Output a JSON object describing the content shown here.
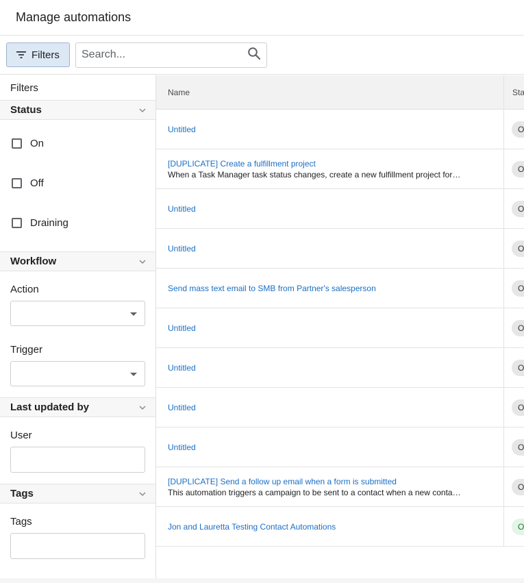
{
  "header": {
    "title": "Manage automations"
  },
  "toolbar": {
    "filters_label": "Filters",
    "search_placeholder": "Search..."
  },
  "sidebar": {
    "title": "Filters",
    "status": {
      "label": "Status",
      "options": [
        "On",
        "Off",
        "Draining"
      ]
    },
    "workflow": {
      "label": "Workflow",
      "action_label": "Action",
      "action_value": "",
      "trigger_label": "Trigger",
      "trigger_value": ""
    },
    "last_updated": {
      "label": "Last updated by",
      "user_label": "User",
      "user_value": ""
    },
    "tags": {
      "label": "Tags",
      "tags_label": "Tags",
      "tags_value": ""
    }
  },
  "table": {
    "columns": [
      "Name",
      "Sta"
    ],
    "rows": [
      {
        "name": "Untitled",
        "description": "",
        "status": "O"
      },
      {
        "name": "[DUPLICATE] Create a fulfillment project",
        "description": "When a Task Manager task status changes, create a new fulfillment project for the account",
        "status": "O"
      },
      {
        "name": "Untitled",
        "description": "",
        "status": "O"
      },
      {
        "name": "Untitled",
        "description": "",
        "status": "O"
      },
      {
        "name": "Send mass text email to SMB from Partner's salesperson",
        "description": "",
        "status": "O"
      },
      {
        "name": "Untitled",
        "description": "",
        "status": "O"
      },
      {
        "name": "Untitled",
        "description": "",
        "status": "O"
      },
      {
        "name": "Untitled",
        "description": "",
        "status": "O"
      },
      {
        "name": "Untitled",
        "description": "",
        "status": "O"
      },
      {
        "name": "[DUPLICATE] Send a follow up email when a form is submitted",
        "description": "This automation triggers a campaign to be sent to a contact when a new contact submits a form",
        "status": "O"
      },
      {
        "name": "Jon and Lauretta Testing Contact Automations",
        "description": "",
        "status": "O",
        "status_on": true
      }
    ]
  }
}
